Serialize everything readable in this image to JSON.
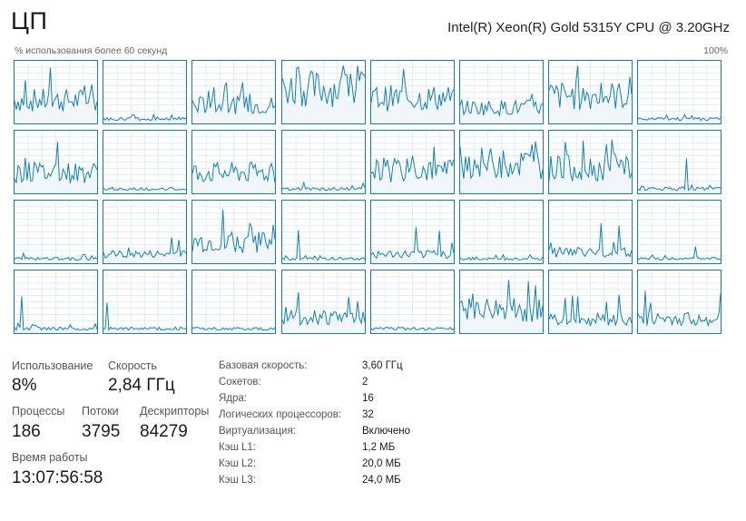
{
  "header": {
    "title": "ЦП",
    "cpu_name": "Intel(R) Xeon(R) Gold 5315Y CPU @ 3.20GHz",
    "graph_caption": "% использования более 60 секунд",
    "graph_max": "100%"
  },
  "graph": {
    "columns": 8,
    "rows": 4,
    "line_color": "#117dbb",
    "fill_color": "#f1f6fa",
    "grid_color": "#d9eaf4"
  },
  "stats": {
    "usage_label": "Использование",
    "usage_value": "8%",
    "speed_label": "Скорость",
    "speed_value": "2,84 ГГц",
    "processes_label": "Процессы",
    "processes_value": "186",
    "threads_label": "Потоки",
    "threads_value": "3795",
    "handles_label": "Дескрипторы",
    "handles_value": "84279",
    "uptime_label": "Время работы",
    "uptime_value": "13:07:56:58"
  },
  "details": [
    {
      "label": "Базовая скорость:",
      "value": "3,60 ГГц"
    },
    {
      "label": "Сокетов:",
      "value": "2"
    },
    {
      "label": "Ядра:",
      "value": "16"
    },
    {
      "label": "Логических процессоров:",
      "value": "32"
    },
    {
      "label": "Виртуализация:",
      "value": "Включено"
    },
    {
      "label": "Кэш L1:",
      "value": "1,2 МБ"
    },
    {
      "label": "Кэш L2:",
      "value": "20,0 МБ"
    },
    {
      "label": "Кэш L3:",
      "value": "24,0 МБ"
    }
  ]
}
